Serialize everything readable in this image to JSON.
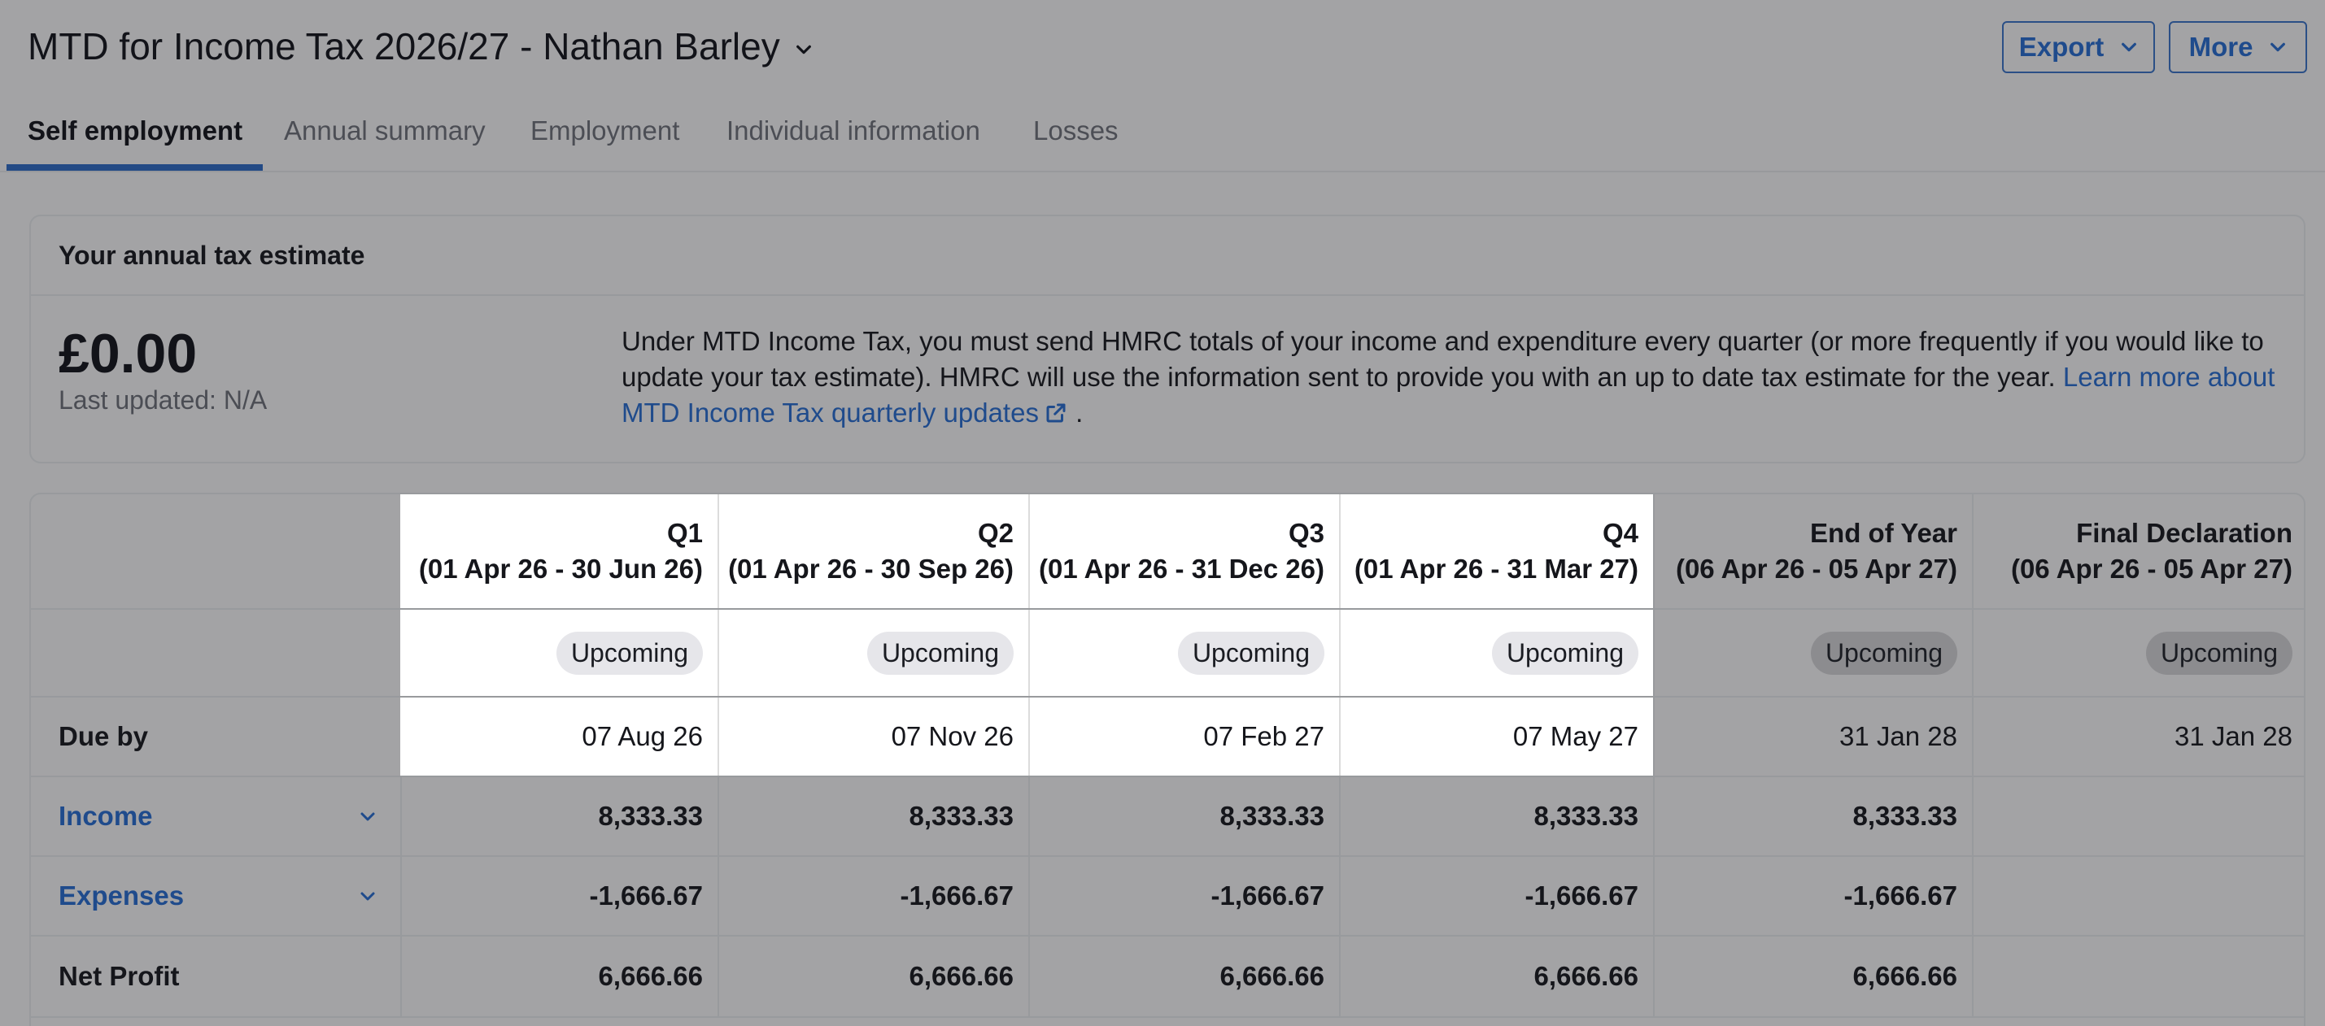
{
  "header": {
    "title": "MTD for Income Tax 2026/27 - Nathan Barley",
    "export_label": "Export",
    "more_label": "More"
  },
  "tabs": [
    {
      "label": "Self employment",
      "active": true
    },
    {
      "label": "Annual summary",
      "active": false
    },
    {
      "label": "Employment",
      "active": false
    },
    {
      "label": "Individual information",
      "active": false
    },
    {
      "label": "Losses",
      "active": false
    }
  ],
  "estimate": {
    "heading": "Your annual tax estimate",
    "amount": "£0.00",
    "last_updated": "Last updated: N/A",
    "description": "Under MTD Income Tax, you must send HMRC totals of your income and expenditure every quarter (or more frequently if you would like to update your tax estimate). HMRC will use the information sent to provide you with an up to date tax estimate for the year. ",
    "link_text": "Learn more about MTD Income Tax quarterly updates",
    "trailing": "."
  },
  "table": {
    "columns": [
      {
        "title": "Q1",
        "period": "(01 Apr 26 - 30 Jun 26)",
        "status": "Upcoming",
        "due": "07 Aug 26",
        "income": "8,333.33",
        "expenses": "-1,666.67",
        "net_profit": "6,666.66"
      },
      {
        "title": "Q2",
        "period": "(01 Apr 26 - 30 Sep 26)",
        "status": "Upcoming",
        "due": "07 Nov 26",
        "income": "8,333.33",
        "expenses": "-1,666.67",
        "net_profit": "6,666.66"
      },
      {
        "title": "Q3",
        "period": "(01 Apr 26 - 31 Dec 26)",
        "status": "Upcoming",
        "due": "07 Feb 27",
        "income": "8,333.33",
        "expenses": "-1,666.67",
        "net_profit": "6,666.66"
      },
      {
        "title": "Q4",
        "period": "(01 Apr 26 - 31 Mar 27)",
        "status": "Upcoming",
        "due": "07 May 27",
        "income": "8,333.33",
        "expenses": "-1,666.67",
        "net_profit": "6,666.66"
      },
      {
        "title": "End of Year",
        "period": "(06 Apr 26 - 05 Apr 27)",
        "status": "Upcoming",
        "due": "31 Jan 28",
        "income": "8,333.33",
        "expenses": "-1,666.67",
        "net_profit": "6,666.66"
      },
      {
        "title": "Final Declaration",
        "period": "(06 Apr 26 - 05 Apr 27)",
        "status": "Upcoming",
        "due": "31 Jan 28",
        "income": "",
        "expenses": "",
        "net_profit": ""
      }
    ],
    "row_labels": {
      "due_by": "Due by",
      "income": "Income",
      "expenses": "Expenses",
      "net_profit": "Net Profit"
    }
  }
}
